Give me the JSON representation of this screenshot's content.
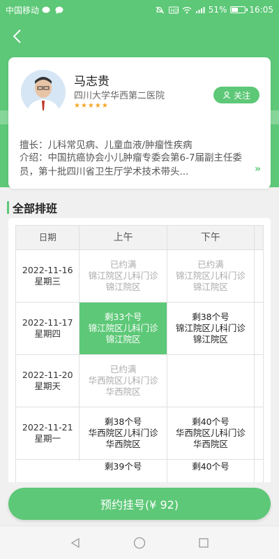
{
  "status_bar": {
    "carrier": "中国移动",
    "battery_percent": "51%",
    "battery_level": 0.51,
    "time": "16:05",
    "network": "4G"
  },
  "doctor": {
    "name": "马志贵",
    "hospital": "四川大学华西第二医院",
    "rating_stars": "★★★★★",
    "follow_label": "关注",
    "specialty": "擅长：儿科常见病、儿童血液/肿瘤性疾病",
    "intro": "介绍：中国抗癌协会小儿肿瘤专委会第6-7届副主任委员，第十批四川省卫生厅学术技术带头..."
  },
  "schedule": {
    "section_title": "全部排班",
    "headers": {
      "date": "日期",
      "am": "上午",
      "pm": "下午"
    },
    "rows": [
      {
        "date": "2022-11-16",
        "weekday": "星期三",
        "am": {
          "status": "已约满",
          "clinic": "锦江院区儿科门诊",
          "campus": "锦江院区"
        },
        "pm": {
          "status": "已约满",
          "clinic": "锦江院区儿科门诊",
          "campus": "锦江院区"
        }
      },
      {
        "date": "2022-11-17",
        "weekday": "星期四",
        "am": {
          "status": "剩33个号",
          "clinic": "锦江院区儿科门诊",
          "campus": "锦江院区"
        },
        "pm": {
          "status": "剩38个号",
          "clinic": "锦江院区儿科门诊",
          "campus": "锦江院区"
        }
      },
      {
        "date": "2022-11-20",
        "weekday": "星期天",
        "am": {
          "status": "已约满",
          "clinic": "华西院区儿科门诊",
          "campus": "华西院区"
        },
        "pm": {
          "status": "",
          "clinic": "",
          "campus": ""
        }
      },
      {
        "date": "2022-11-21",
        "weekday": "星期一",
        "am": {
          "status": "剩38个号",
          "clinic": "华西院区儿科门诊",
          "campus": "华西院区"
        },
        "pm": {
          "status": "剩40个号",
          "clinic": "华西院区儿科门诊",
          "campus": "华西院区"
        }
      },
      {
        "date": "",
        "weekday": "",
        "am": {
          "status": "剩39个号",
          "clinic": "",
          "campus": ""
        },
        "pm": {
          "status": "剩40个号",
          "clinic": "",
          "campus": ""
        }
      }
    ]
  },
  "book_button": "预约挂号(¥ 92)",
  "colors": {
    "accent": "#5dc877",
    "star": "#f5a623"
  }
}
